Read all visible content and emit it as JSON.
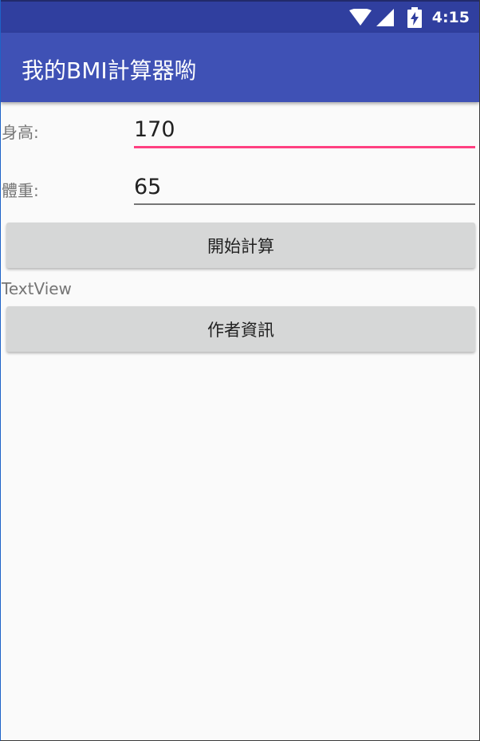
{
  "status_bar": {
    "time": "4:15",
    "icons": [
      "wifi-icon",
      "cellular-signal-icon",
      "battery-charging-icon"
    ]
  },
  "app_bar": {
    "title": "我的BMI計算器喲"
  },
  "form": {
    "height_label": "身高:",
    "height_value": "170",
    "weight_label": "體重:",
    "weight_value": "65",
    "calculate_label": "開始計算",
    "result_text": "TextView",
    "author_label": "作者資訊"
  },
  "colors": {
    "status_bar": "#303f9f",
    "app_bar": "#3f51b5",
    "accent": "#ff4081",
    "button": "#d6d7d7",
    "background": "#fafafa"
  }
}
